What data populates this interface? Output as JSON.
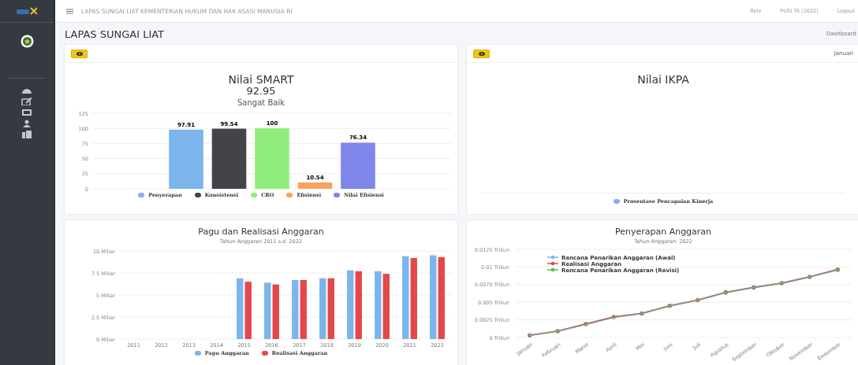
{
  "topbar": {
    "title": "LAPAS SUNGAI LIAT KEMENTERIAN HUKUM DAN HAK ASASI MANUSIA RI",
    "links": [
      "Role",
      "PUSI TA (2022)",
      "Logout"
    ]
  },
  "page": {
    "title": "LAPAS SUNGAI LIAT",
    "breadcrumb": "Dashboard"
  },
  "smart_card": {
    "score": "92.95",
    "rating": "Sangat Baik",
    "chart_data": {
      "type": "bar",
      "grid": true,
      "title": "Nilai SMART",
      "ylim": [
        0,
        125
      ],
      "yticks": [
        0,
        25,
        50,
        75,
        100,
        125
      ],
      "data_labels": true,
      "series": [
        {
          "name": "Penyerapan",
          "color": "#7cb5ec",
          "values": [
            97.91
          ]
        },
        {
          "name": "Konsistensi",
          "color": "#434348",
          "values": [
            99.54
          ]
        },
        {
          "name": "CRO",
          "color": "#90ed7d",
          "values": [
            100
          ]
        },
        {
          "name": "Efisiensi",
          "color": "#f7a35c",
          "values": [
            10.54
          ]
        },
        {
          "name": "Nilai Efisiensi",
          "color": "#8085e9",
          "values": [
            76.34
          ]
        }
      ]
    }
  },
  "ikpa_card": {
    "month": "Januari",
    "title": "Nilai IKPA",
    "legend": [
      "Prosentase Pencapaian Kinerja"
    ]
  },
  "pagu_card": {
    "subtitle": "Tahun Anggaran 2011 s.d. 2022",
    "chart_data": {
      "type": "bar",
      "grid": true,
      "title": "Pagu dan Realisasi Anggaran",
      "categories": [
        "2011",
        "2012",
        "2013",
        "2014",
        "2015",
        "2016",
        "2017",
        "2018",
        "2019",
        "2020",
        "2021",
        "2022"
      ],
      "ylim": [
        0,
        10
      ],
      "yticks": [
        {
          "value": 0,
          "label": "0 Miliar"
        },
        {
          "value": 2.5,
          "label": "2.5 Miliar"
        },
        {
          "value": 5,
          "label": "5 Miliar"
        },
        {
          "value": 7.5,
          "label": "7.5 Miliar"
        },
        {
          "value": 10,
          "label": "10 Miliar"
        }
      ],
      "series": [
        {
          "name": "Pagu Anggaran",
          "color": "#7cb5ec",
          "values": [
            null,
            null,
            null,
            null,
            6.9,
            6.4,
            6.7,
            6.9,
            7.8,
            7.7,
            9.4,
            9.5
          ]
        },
        {
          "name": "Realisasi Anggaran",
          "color": "#e4484b",
          "values": [
            null,
            null,
            null,
            null,
            6.5,
            6.2,
            6.7,
            6.9,
            7.7,
            7.4,
            9.2,
            9.3
          ]
        }
      ]
    }
  },
  "penyerapan_card": {
    "subtitle": "Tahun Anggaran: 2022",
    "chart_data": {
      "type": "line",
      "grid": true,
      "legend": "top-left",
      "title": "Penyerapan Anggaran",
      "categories": [
        "Januari",
        "Februari",
        "Maret",
        "April",
        "Mei",
        "Juni",
        "Juli",
        "Agustus",
        "September",
        "Oktober",
        "November",
        "Desember"
      ],
      "ylim": [
        0,
        0.0125
      ],
      "yticks": [
        {
          "value": 0,
          "label": "0 Triliun"
        },
        {
          "value": 0.0025,
          "label": "0.0025 Triliun"
        },
        {
          "value": 0.005,
          "label": "0.005 Triliun"
        },
        {
          "value": 0.0075,
          "label": "0.0075 Triliun"
        },
        {
          "value": 0.01,
          "label": "0.01 Triliun"
        },
        {
          "value": 0.0125,
          "label": "0.0125 Triliun"
        }
      ],
      "series": [
        {
          "name": "Rencana Penarikan Anggaran (Awal)",
          "color": "#7cb5ec",
          "values": [
            0.0003,
            0.0009,
            0.0018,
            0.0028,
            0.0034,
            0.0045,
            0.0053,
            0.0064,
            0.0071,
            0.0077,
            0.0086,
            0.0096
          ]
        },
        {
          "name": "Realisasi Anggaran",
          "color": "#e4484b",
          "values": [
            0.0003,
            0.0009,
            0.0019,
            0.0029,
            0.0034,
            0.0045,
            0.0053,
            0.0064,
            0.0071,
            0.0077,
            0.0086,
            0.0097
          ]
        },
        {
          "name": "Rencana Penarikan Anggaran (Revisi)",
          "color": "#5cb85c",
          "values": [
            0.0003,
            0.0009,
            0.0019,
            0.0029,
            0.0034,
            0.0045,
            0.0053,
            0.0064,
            0.0071,
            0.0077,
            0.0086,
            0.0096
          ]
        }
      ]
    }
  }
}
